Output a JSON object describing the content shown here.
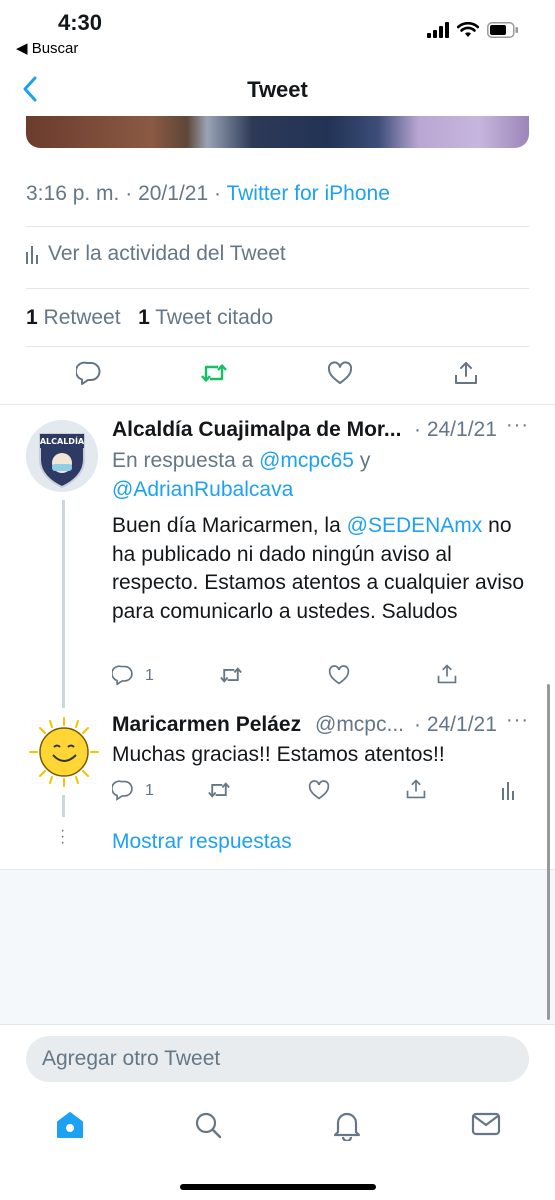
{
  "status_bar": {
    "time": "4:30",
    "back_app": "◀ Buscar"
  },
  "nav": {
    "title": "Tweet"
  },
  "tweet": {
    "time": "3:16 p. m.",
    "sep1": "·",
    "date": "20/1/21",
    "sep2": "·",
    "source": "Twitter for iPhone",
    "activity_label": "Ver la actividad del Tweet",
    "retweet_count": "1",
    "retweet_label": "Retweet",
    "quote_count": "1",
    "quote_label": "Tweet citado"
  },
  "replies": [
    {
      "name": "Alcaldía Cuajimalpa de Mor...",
      "date": "· 24/1/21",
      "reply_prefix": "En respuesta a",
      "mention1": "@mcpc65",
      "reply_y": "y",
      "mention2": "@AdrianRubalcava",
      "text_before": "Buen día Maricarmen, la",
      "text_mention": "@SEDENAmx",
      "text_after": "no ha publicado ni dado ningún aviso al respecto. Estamos atentos a cualquier aviso para comunicarlo a ustedes. Saludos",
      "reply_count": "1",
      "avatar_text": "ALCALDÍA"
    },
    {
      "name": "Maricarmen Peláez",
      "handle": "@mcpc...",
      "date": "· 24/1/21",
      "text": "Muchas gracias!! Estamos atentos!!",
      "reply_count": "1"
    }
  ],
  "show_replies": "Mostrar respuestas",
  "more": "···",
  "compose": {
    "placeholder": "Agregar otro Tweet"
  },
  "colors": {
    "accent": "#1da1f2",
    "retweet": "#17bf63",
    "text": "#14171a",
    "secondary": "#657786",
    "divider": "#e1e8ed"
  },
  "icons": [
    "back-chevron-icon",
    "signal-icon",
    "wifi-icon",
    "battery-icon",
    "activity-chart-icon",
    "reply-icon",
    "retweet-icon",
    "like-icon",
    "share-icon",
    "more-icon",
    "home-icon",
    "search-icon",
    "notifications-icon",
    "messages-icon"
  ]
}
